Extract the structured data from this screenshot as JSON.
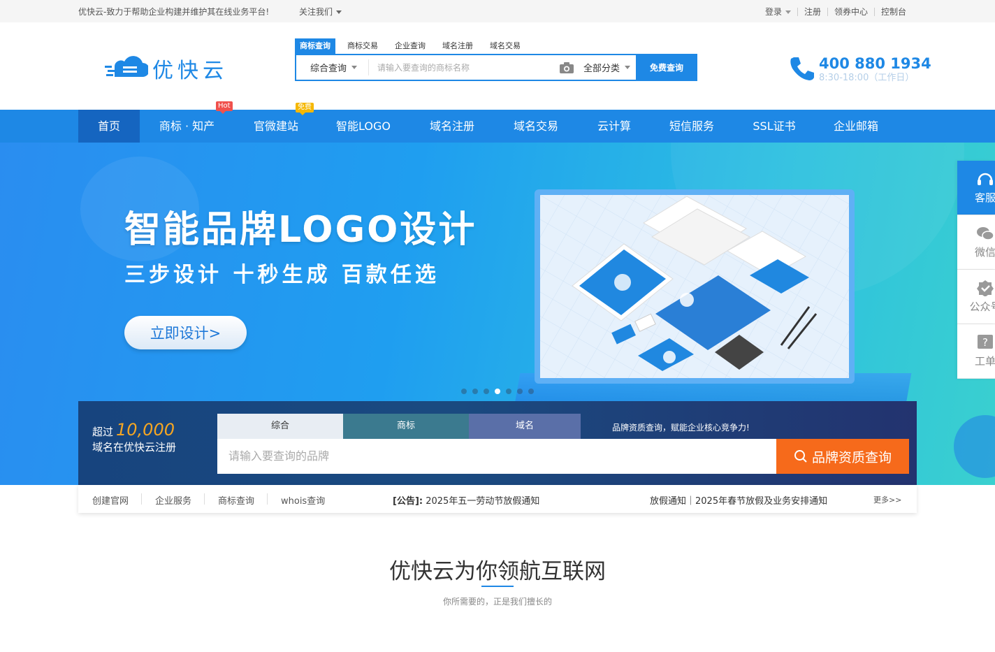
{
  "topbar": {
    "slogan": "优快云-致力于帮助企业构建并维护其在线业务平台!",
    "follow": "关注我们",
    "links": [
      "登录",
      "注册",
      "领券中心",
      "控制台"
    ]
  },
  "header": {
    "logo_text": "优快云",
    "search_tabs": [
      "商标查询",
      "商标交易",
      "企业查询",
      "域名注册",
      "域名交易"
    ],
    "scope": "综合查询",
    "placeholder": "请输入要查询的商标名称",
    "category": "全部分类",
    "search_button": "免费查询",
    "hotline": "400 880 1934",
    "hours": "8:30-18:00（工作日）"
  },
  "nav": {
    "items": [
      "首页",
      "商标 · 知产",
      "官微建站",
      "智能LOGO",
      "域名注册",
      "域名交易",
      "云计算",
      "短信服务",
      "SSL证书",
      "企业邮箱"
    ],
    "badge_hot": "Hot",
    "badge_free": "免费"
  },
  "banner": {
    "title": "智能品牌LOGO设计",
    "subtitle": "三步设计  十秒生成  百款任选",
    "cta": "立即设计>",
    "slides": 7,
    "active_slide": 4
  },
  "query": {
    "stat_prefix": "超过",
    "stat_number": "10,000",
    "stat_suffix": "域名在优快云注册",
    "tabs": [
      "综合",
      "商标",
      "域名"
    ],
    "tip": "品牌资质查询，赋能企业核心竞争力!",
    "placeholder": "请输入要查询的品牌",
    "button": "品牌资质查询"
  },
  "quicklinks": {
    "items": [
      "创建官网",
      "企业服务",
      "商标查询",
      "whois查询"
    ],
    "notice_label": "[公告]:",
    "notice": "2025年五一劳动节放假通知",
    "notice2": "放假通知｜2025年春节放假及业务安排通知",
    "more": "更多>>"
  },
  "section": {
    "title": "优快云为你领航互联网",
    "subtitle": "你所需要的，正是我们擅长的"
  },
  "side": {
    "items": [
      "客服",
      "微信",
      "公众号",
      "工单"
    ]
  },
  "colors": {
    "brand": "#1e88e5",
    "orange": "#f66a1b",
    "hot": "#f0514d",
    "free": "#f5b700"
  }
}
